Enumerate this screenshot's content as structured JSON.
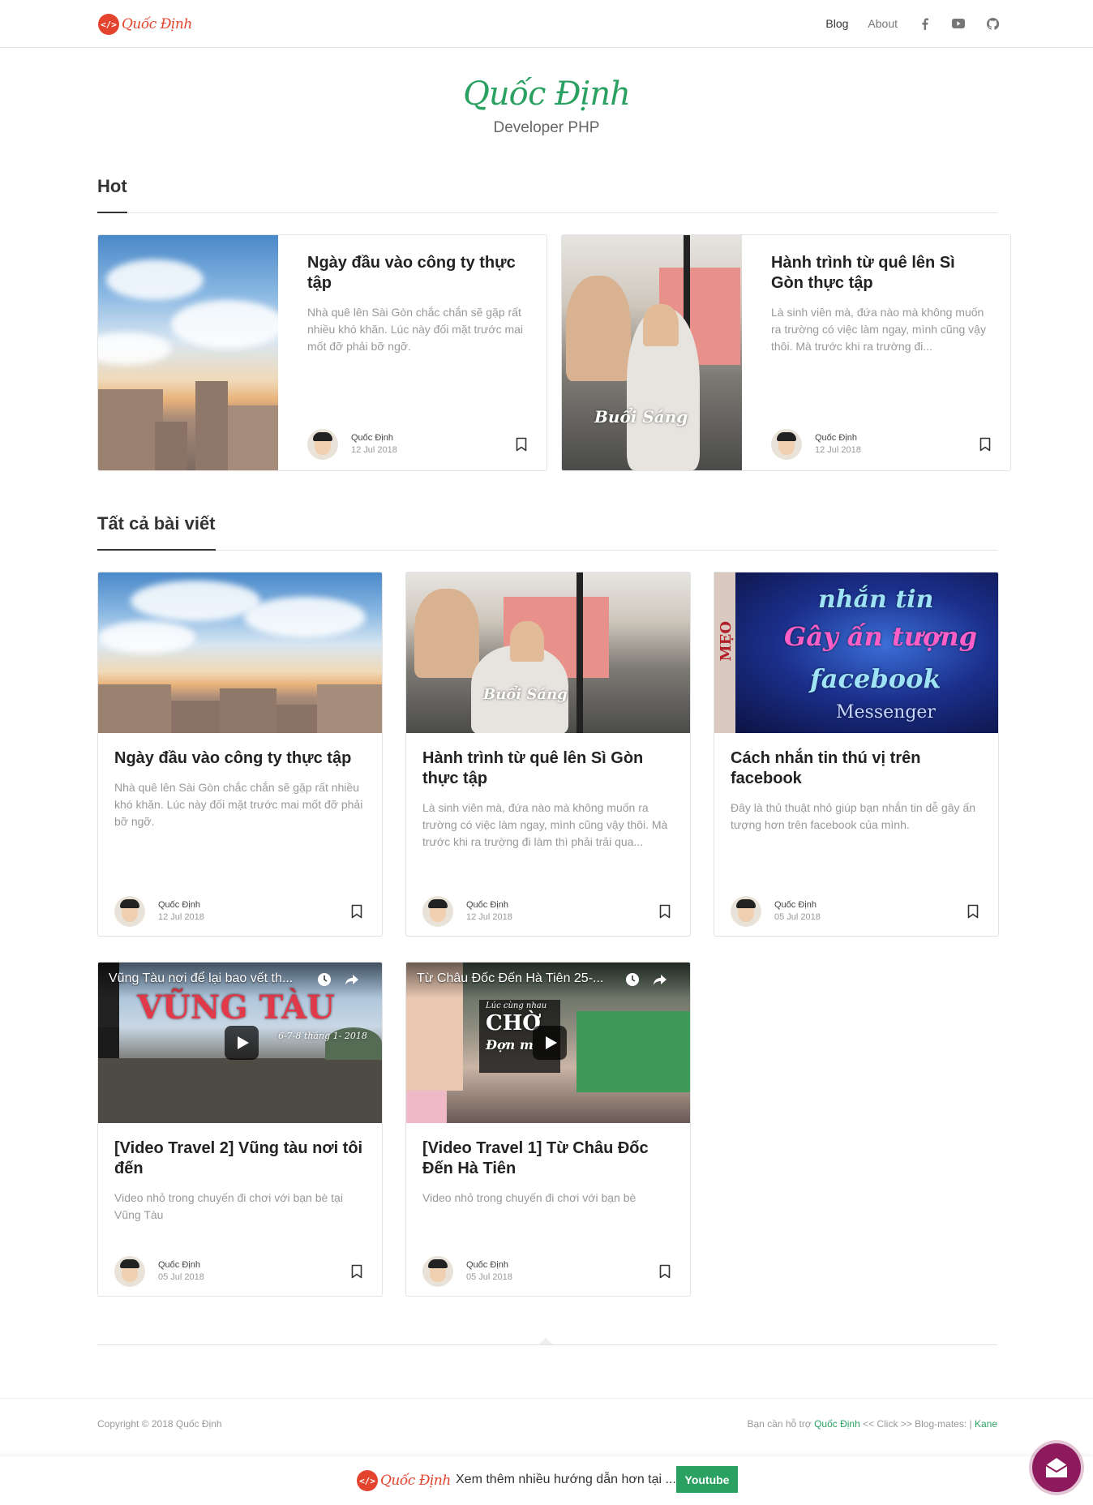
{
  "nav": {
    "brand": "Quốc Định",
    "brand_badge": "</>",
    "links": [
      "Blog",
      "About"
    ],
    "icons": [
      "facebook-icon",
      "youtube-icon",
      "github-icon"
    ]
  },
  "hero": {
    "title": "Quốc Định",
    "subtitle": "Developer PHP"
  },
  "sections": {
    "hot": "Hot",
    "all_posts": "Tất cả bài viết"
  },
  "hot_posts": [
    {
      "title": "Ngày đầu vào công ty thực tập",
      "excerpt": "Nhà quê lên Sài Gòn chắc chắn sẽ gặp rất nhiều khó khăn. Lúc này đối mặt trước mai mốt đỡ phải bỡ ngỡ.",
      "author": "Quốc Định",
      "date": "12 Jul 2018"
    },
    {
      "title": "Hành trình từ quê lên Sì Gòn thực tập",
      "excerpt": "Là sinh viên mà, đứa nào mà không muốn ra trường có việc làm ngay, mình cũng vậy thôi. Mà trước khi ra trường đi...",
      "author": "Quốc Định",
      "date": "12 Jul 2018",
      "image_text": "Buổi Sáng"
    }
  ],
  "posts": [
    {
      "title": "Ngày đầu vào công ty thực tập",
      "excerpt": "Nhà quê lên Sài Gòn chắc chắn sẽ gặp rất nhiều khó khăn. Lúc này đối mặt trước mai mốt đỡ phải bỡ ngỡ.",
      "author": "Quốc Định",
      "date": "12 Jul 2018"
    },
    {
      "title": "Hành trình từ quê lên Sì Gòn thực tập",
      "excerpt": "Là sinh viên mà, đứa nào mà không muốn ra trường có việc làm ngay, mình cũng vậy thôi. Mà trước khi ra trường đi làm thì phải trải qua...",
      "author": "Quốc Định",
      "date": "12 Jul 2018",
      "image_text": "Buổi Sáng"
    },
    {
      "title": "Cách nhắn tin thú vị trên facebook",
      "excerpt": "Đây là thủ thuật nhỏ giúp bạn nhắn tin dễ gây ấn tượng hơn trên facebook của mình.",
      "author": "Quốc Định",
      "date": "05 Jul 2018",
      "image_lines": [
        "nhắn tin",
        "Gây ấn tượng",
        "facebook",
        "Messenger",
        "MẸO"
      ]
    },
    {
      "title": "[Video Travel 2] Vũng tàu nơi tôi đến",
      "excerpt": "Video nhỏ trong chuyến đi chơi với bạn bè tại Vũng Tàu",
      "author": "Quốc Định",
      "date": "05 Jul 2018",
      "video_title": "Vũng Tàu nơi để lại bao vết th...",
      "image_lines": [
        "VŨNG TÀU",
        "6-7-8 tháng 1- 2018"
      ]
    },
    {
      "title": "[Video Travel 1] Từ Châu Đốc Đến Hà Tiên",
      "excerpt": "Video nhỏ trong chuyến đi chơi với bạn bè",
      "author": "Quốc Định",
      "date": "05 Jul 2018",
      "video_title": "Từ Châu Đốc Đến Hà Tiên 25-...",
      "image_lines": [
        "Lúc cùng nhau",
        "CHỜ",
        "Đợn m"
      ]
    }
  ],
  "footer": {
    "copyright": "Copyright © 2018 Quốc Định",
    "support_prefix": "Bạn cần hỗ trợ",
    "support_link": "Quốc Định",
    "click_text": "<< Click >> Blog-mates: |",
    "mate_link": "Kane"
  },
  "bottom_bar": {
    "brand": "Quốc Định",
    "text": "Xem thêm nhiều hướng dẫn hơn tại ...",
    "button": "Youtube"
  },
  "colors": {
    "brand_red": "#e4432d",
    "accent_green": "#2aa161",
    "fab_purple": "#8c1a5c"
  }
}
